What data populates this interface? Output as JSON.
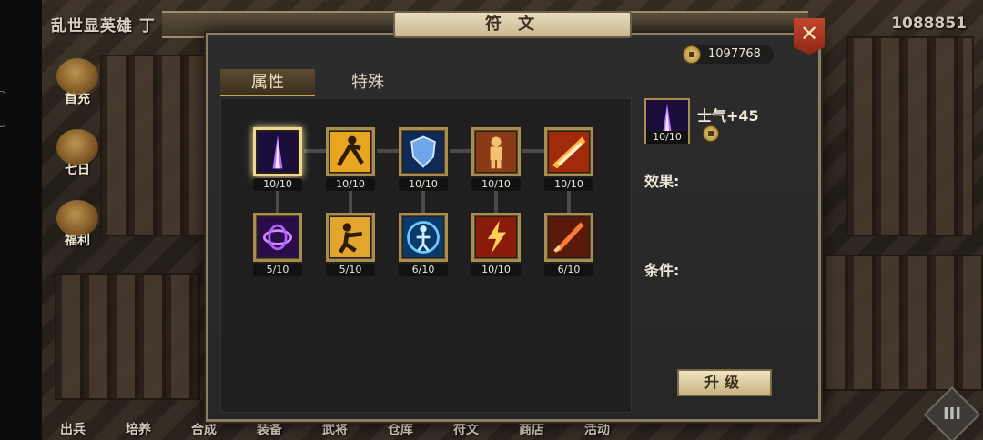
{
  "header": {
    "player_title": "乱世显英雄 丁",
    "resource_count": "1088851"
  },
  "side_menu": [
    {
      "label": "首充",
      "icon": "gift-icon"
    },
    {
      "label": "七日",
      "icon": "scroll-icon"
    },
    {
      "label": "福利",
      "icon": "treasure-icon"
    }
  ],
  "bottom_nav": [
    {
      "label": "出兵"
    },
    {
      "label": "培养"
    },
    {
      "label": "合成"
    },
    {
      "label": "装备"
    },
    {
      "label": "武将"
    },
    {
      "label": "仓库"
    },
    {
      "label": "符文"
    },
    {
      "label": "商店"
    },
    {
      "label": "活动"
    }
  ],
  "menu_button": "III",
  "dialog": {
    "title": "符 文",
    "close_label": "✕",
    "currency": "1097768",
    "tabs": [
      {
        "label": "属性",
        "active": true
      },
      {
        "label": "特殊",
        "active": false
      }
    ],
    "runes": [
      {
        "icon": "purple-beam-icon",
        "count": "10/10",
        "selected": true
      },
      {
        "icon": "running-figure-icon",
        "count": "10/10"
      },
      {
        "icon": "shield-icon",
        "count": "10/10"
      },
      {
        "icon": "warrior-icon",
        "count": "10/10"
      },
      {
        "icon": "fire-slash-icon",
        "count": "10/10"
      },
      {
        "icon": "purple-vortex-icon",
        "count": "5/10"
      },
      {
        "icon": "kick-figure-icon",
        "count": "5/10"
      },
      {
        "icon": "blue-figure-icon",
        "count": "6/10"
      },
      {
        "icon": "lightning-strike-icon",
        "count": "10/10"
      },
      {
        "icon": "fire-sword-icon",
        "count": "6/10"
      }
    ],
    "detail": {
      "name": "士气+45",
      "count": "10/10",
      "effect_label": "效果:",
      "condition_label": "条件:",
      "upgrade_label": "升级"
    }
  }
}
